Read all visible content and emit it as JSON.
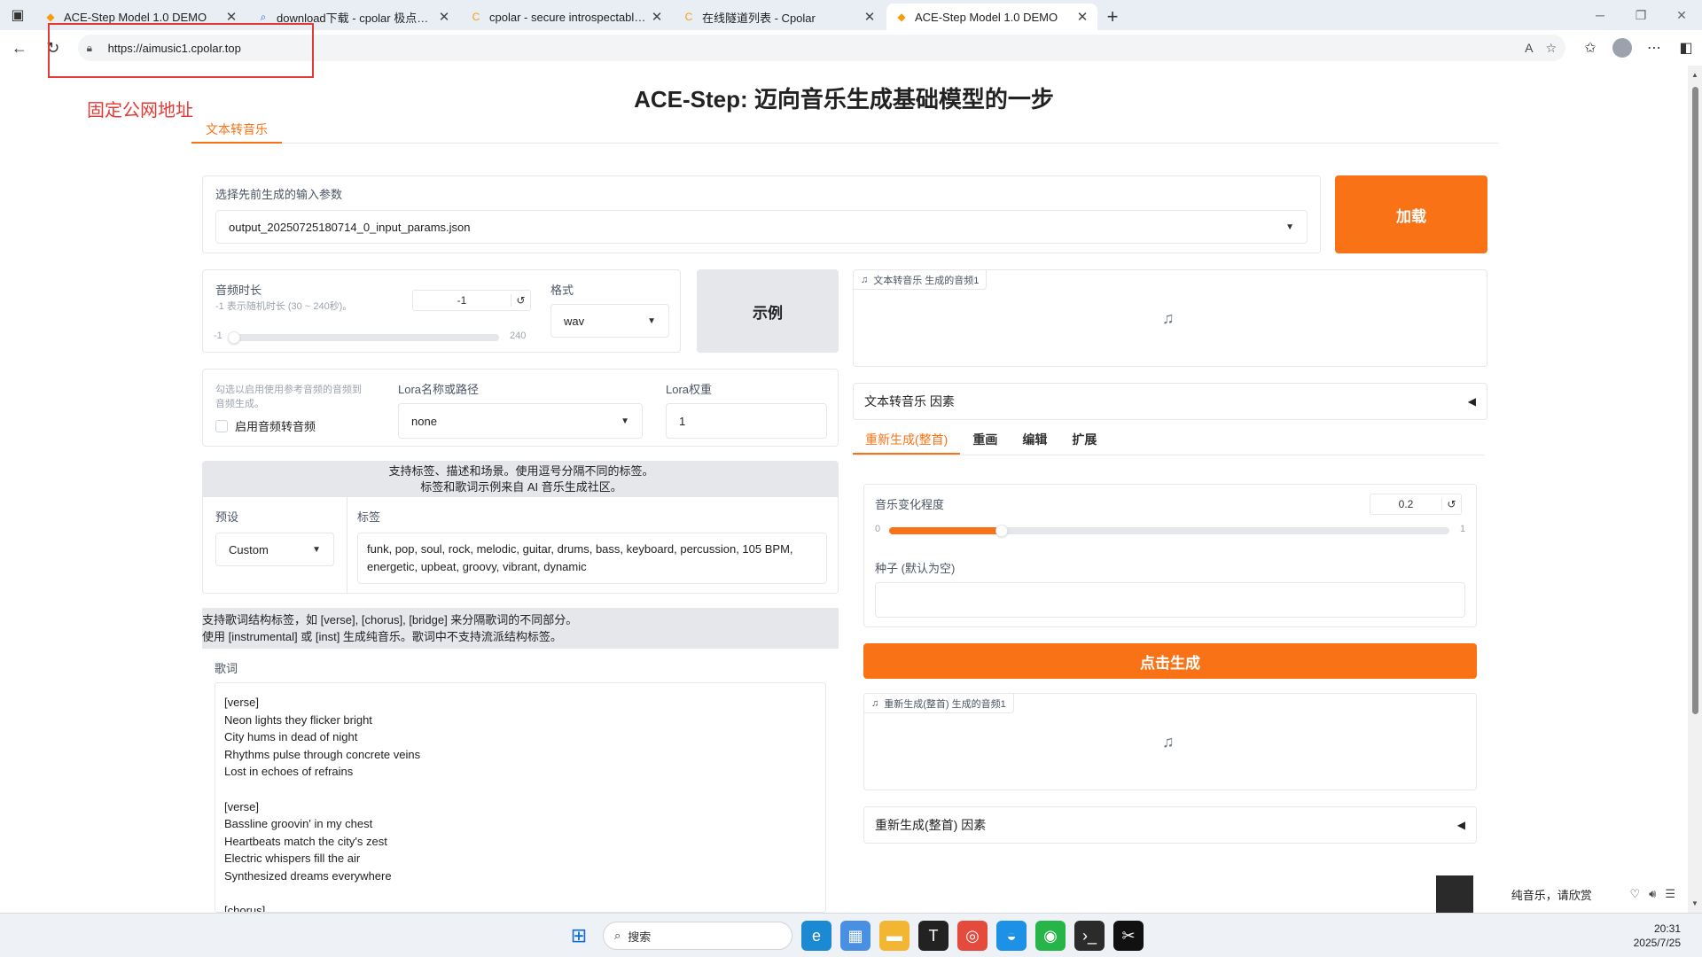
{
  "browser": {
    "tabs": [
      {
        "title": "ACE-Step Model 1.0 DEMO",
        "favicon": "orange-sparkle-icon",
        "active": false
      },
      {
        "title": "download下载 - cpolar 极点云官网",
        "favicon": "search-icon",
        "active": false
      },
      {
        "title": "cpolar - secure introspectable tunnels",
        "favicon": "cpolar-icon",
        "active": false
      },
      {
        "title": "在线隧道列表 - Cpolar",
        "favicon": "cpolar-icon",
        "active": false
      },
      {
        "title": "ACE-Step Model 1.0 DEMO",
        "favicon": "orange-sparkle-icon",
        "active": true
      }
    ],
    "url": "https://aimusic1.cpolar.top"
  },
  "annotation": {
    "note": "固定公网地址",
    "color": "#e53935"
  },
  "app": {
    "title": "ACE-Step: 迈向音乐生成基础模型的一步",
    "main_tab": "文本转音乐",
    "accent": "#f97316"
  },
  "params_select": {
    "label": "选择先前生成的输入参数",
    "value": "output_20250725180714_0_input_params.json",
    "load_button": "加载"
  },
  "duration": {
    "label": "音频时长",
    "hint": "-1 表示随机时长 (30 ~ 240秒)。",
    "value": "-1",
    "min": "-1",
    "max": "240",
    "level": 0.0
  },
  "format": {
    "label": "格式",
    "value": "wav"
  },
  "example_button": "示例",
  "ref_audio": {
    "hint_line1": "勾选以启用使用参考音频的音频到",
    "hint_line2": "音频生成。",
    "checkbox_label": "启用音频转音频"
  },
  "lora": {
    "path_label": "Lora名称或路径",
    "path_value": "none",
    "weight_label": "Lora权重",
    "weight_value": "1"
  },
  "tags_section": {
    "header_line1": "支持标签、描述和场景。使用逗号分隔不同的标签。",
    "header_line2": "标签和歌词示例来自 AI 音乐生成社区。",
    "preset_label": "预设",
    "preset_value": "Custom",
    "tags_label": "标签",
    "tags_line1": "funk, pop, soul, rock, melodic, guitar, drums, bass, keyboard, percussion, 105 BPM,",
    "tags_line2": "energetic, upbeat, groovy, vibrant, dynamic"
  },
  "lyrics_section": {
    "header_line1": "支持歌词结构标签，如 [verse], [chorus], [bridge] 来分隔歌词的不同部分。",
    "header_line2": "使用 [instrumental] 或 [inst] 生成纯音乐。歌词中不支持流派结构标签。",
    "label": "歌词",
    "text": "[verse]\nNeon lights they flicker bright\nCity hums in dead of night\nRhythms pulse through concrete veins\nLost in echoes of refrains\n\n[verse]\nBassline groovin' in my chest\nHeartbeats match the city's zest\nElectric whispers fill the air\nSynthesized dreams everywhere\n\n[chorus]"
  },
  "output_audio": {
    "label": "文本转音乐 生成的音频1"
  },
  "output_factors": {
    "label": "文本转音乐 因素"
  },
  "sub_tabs": [
    "重新生成(整首)",
    "重画",
    "编辑",
    "扩展"
  ],
  "regen": {
    "variance_label": "音乐变化程度",
    "variance_value": "0.2",
    "min": "0",
    "max": "1",
    "level": 0.2,
    "seed_label": "种子 (默认为空)",
    "seed_value": "",
    "generate_button": "点击生成",
    "audio_label": "重新生成(整首) 生成的音频1",
    "factors_label": "重新生成(整首) 因素"
  },
  "mini_player": {
    "text": "纯音乐，请欣赏"
  },
  "taskbar": {
    "search_placeholder": "搜索",
    "time": "20:31",
    "date": "2025/7/25"
  }
}
